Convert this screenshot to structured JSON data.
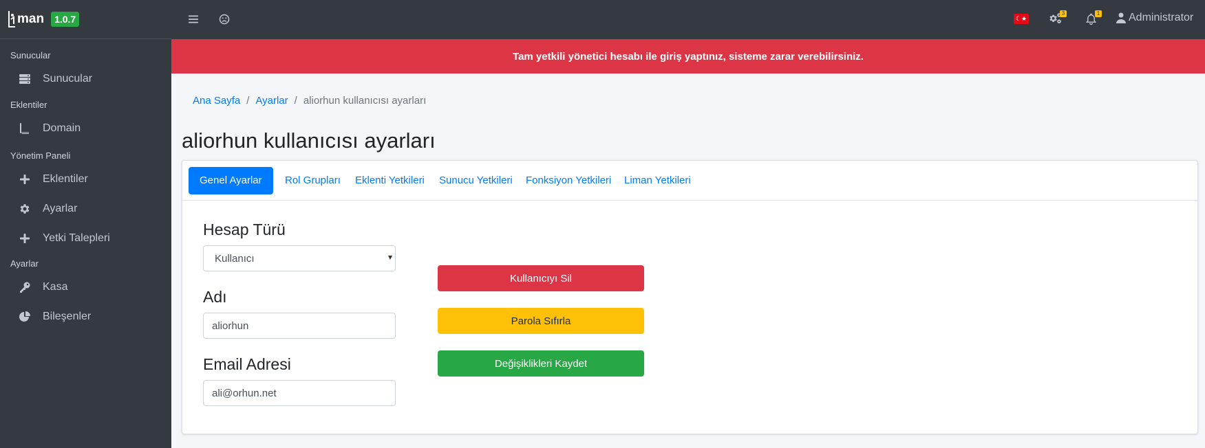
{
  "app": {
    "logo_text": "man",
    "version": "1.0.7"
  },
  "sidebar": {
    "sections": [
      {
        "header": "Sunucular",
        "items": [
          {
            "label": "Sunucular",
            "icon": "server-icon"
          }
        ]
      },
      {
        "header": "Eklentiler",
        "items": [
          {
            "label": "Domain",
            "icon": "book-icon"
          }
        ]
      },
      {
        "header": "Yönetim Paneli",
        "items": [
          {
            "label": "Eklentiler",
            "icon": "plus-icon"
          },
          {
            "label": "Ayarlar",
            "icon": "gear-icon"
          },
          {
            "label": "Yetki Talepleri",
            "icon": "plus-icon"
          }
        ]
      },
      {
        "header": "Ayarlar",
        "items": [
          {
            "label": "Kasa",
            "icon": "key-icon"
          },
          {
            "label": "Bileşenler",
            "icon": "pie-chart-icon"
          }
        ]
      }
    ]
  },
  "topbar": {
    "flag_symbol": "☾★",
    "settings_badge": "3",
    "notifications_badge": "1",
    "user": "Administrator"
  },
  "alert": {
    "text": "Tam yetkili yönetici hesabı ile giriş yaptınız, sisteme zarar verebilirsiniz."
  },
  "breadcrumb": {
    "home": "Ana Sayfa",
    "settings": "Ayarlar",
    "current": "aliorhun kullanıcısı ayarları"
  },
  "page_title": "aliorhun kullanıcısı ayarları",
  "tabs": [
    {
      "label": "Genel Ayarlar",
      "active": true
    },
    {
      "label": "Rol Grupları",
      "active": false
    },
    {
      "label": "Eklenti Yetkileri",
      "active": false
    },
    {
      "label": "Sunucu Yetkileri",
      "active": false
    },
    {
      "label": "Fonksiyon Yetkileri",
      "active": false
    },
    {
      "label": "Liman Yetkileri",
      "active": false
    }
  ],
  "form": {
    "account_type_label": "Hesap Türü",
    "account_type_value": "Kullanıcı",
    "name_label": "Adı",
    "name_value": "aliorhun",
    "email_label": "Email Adresi",
    "email_value": "ali@orhun.net"
  },
  "actions": {
    "delete_user": "Kullanıcıyı Sil",
    "reset_password": "Parola Sıfırla",
    "save_changes": "Değişiklikleri Kaydet"
  },
  "colors": {
    "sidebar_bg": "#343a40",
    "alert_bg": "#dc3545",
    "primary": "#007bff",
    "success": "#28a745",
    "warning": "#ffc107",
    "danger": "#dc3545"
  }
}
